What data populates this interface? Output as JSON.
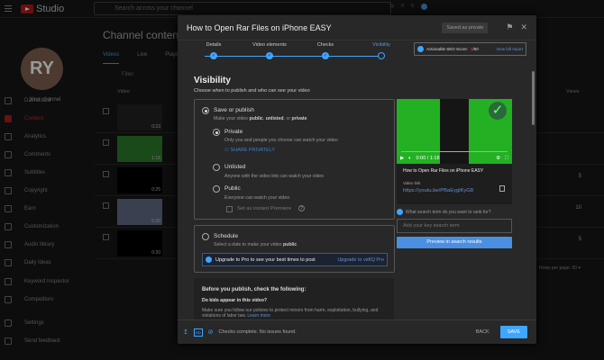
{
  "app": {
    "logo_text": "Studio",
    "search_placeholder": "Search across your channel",
    "top_stats": [
      "1y",
      "0",
      "0"
    ]
  },
  "sidebar": {
    "avatar_initials": "RY",
    "channel_label": "Your channel",
    "items": [
      {
        "label": "Dashboard"
      },
      {
        "label": "Content",
        "active": true
      },
      {
        "label": "Analytics"
      },
      {
        "label": "Comments"
      },
      {
        "label": "Subtitles"
      },
      {
        "label": "Copyright"
      },
      {
        "label": "Earn"
      },
      {
        "label": "Customization"
      },
      {
        "label": "Audio library"
      },
      {
        "label": "Daily Ideas"
      },
      {
        "label": "Keyword Inspector"
      },
      {
        "label": "Competitors"
      },
      {
        "label": "Settings"
      },
      {
        "label": "Send feedback"
      }
    ]
  },
  "content": {
    "title": "Channel content",
    "tabs": [
      "Videos",
      "Live",
      "Playlists"
    ],
    "filter_label": "Filter",
    "col_video": "Video",
    "col_views": "Views",
    "rows": [
      {
        "duration": "0:23",
        "views": ""
      },
      {
        "duration": "1:18",
        "views": ""
      },
      {
        "duration": "0:25",
        "views": "5"
      },
      {
        "duration": "5:35",
        "views": "10"
      },
      {
        "duration": "0:20",
        "views": "5"
      }
    ],
    "rows_per_page_label": "Rows per page:",
    "rows_per_page": "30"
  },
  "dialog": {
    "title": "How to Open Rar Files on iPhone EASY",
    "saved_badge": "Saved as private",
    "steps": [
      "Details",
      "Video elements",
      "Checks",
      "Visibility"
    ],
    "current_step": 3,
    "seo": {
      "label": "Actionable SEO Score:",
      "score": "0",
      "max": "/50",
      "link": "View full report"
    },
    "visibility": {
      "heading": "Visibility",
      "subheading": "Choose when to publish and who can see your video",
      "save_publish": {
        "label": "Save or publish",
        "desc_prefix": "Make your video ",
        "opt1": "public",
        ", ": ", ",
        "opt2": "unlisted",
        "or": ", or ",
        "opt3": "private"
      },
      "options": [
        {
          "label": "Private",
          "desc": "Only you and people you choose can watch your video",
          "selected": true
        },
        {
          "label": "Unlisted",
          "desc": "Anyone with the video link can watch your video",
          "selected": false
        },
        {
          "label": "Public",
          "desc": "Everyone can watch your video",
          "selected": false
        }
      ],
      "share_privately": "SHARE PRIVATELY",
      "premiere": "Set as instant Premiere",
      "schedule": {
        "label": "Schedule",
        "desc_prefix": "Select a date to make your video ",
        "desc_bold": "public"
      },
      "upgrade": {
        "text": "Upgrade to Pro to see your best times to post",
        "link": "Upgrade to vidIQ Pro"
      },
      "before": {
        "heading": "Before you publish, check the following:",
        "q": "Do kids appear in this video?",
        "text": "Make sure you follow our policies to protect minors from harm, exploitation, bullying, and violations of labor law.",
        "link": "Learn more"
      }
    },
    "preview": {
      "time": "0:00 / 1:18",
      "title": "How to Open Rar Files on iPhone EASY",
      "link_label": "Video link",
      "url": "https://youtu.be/PBaEyglKyG8",
      "search_question": "What search term do you want to rank for?",
      "keyword_placeholder": "Add your key search term",
      "preview_button": "Preview in search results"
    },
    "footer": {
      "status": "Checks complete. No issues found.",
      "back": "BACK",
      "save": "SAVE"
    }
  },
  "colors": {
    "accent": "#3ea6ff",
    "green_thumb": "#23b123"
  }
}
